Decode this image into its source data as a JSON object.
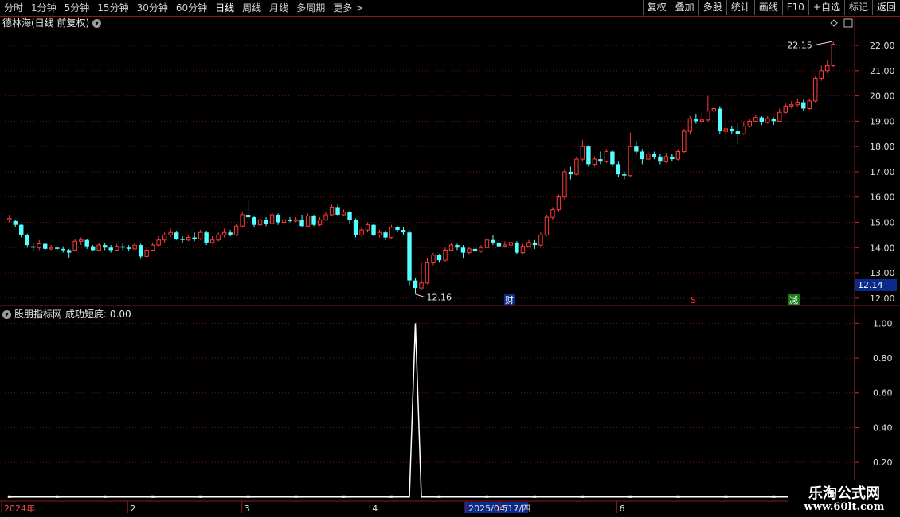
{
  "toolbar": {
    "tabs": [
      "分时",
      "1分钟",
      "5分钟",
      "15分钟",
      "30分钟",
      "60分钟",
      "日线",
      "周线",
      "月线",
      "多周期",
      "更多 >"
    ],
    "active_tab": "日线",
    "right_buttons": [
      "复权",
      "叠加",
      "多股",
      "统计",
      "画线",
      "F10",
      "+自选",
      "标记",
      "返回"
    ]
  },
  "main_chart": {
    "title": "德林海(日线 前复权)",
    "high_label": "22.15",
    "low_label": "12.16",
    "current_price_tag": "12.14",
    "markers": {
      "cai": "财",
      "s": "S",
      "jian": "减"
    }
  },
  "indicator": {
    "title": "股朋指标网",
    "value_label": "成功短底: 0.00"
  },
  "watermark": {
    "line1": "乐淘公式网",
    "line2": "www.60lt.com"
  },
  "colors": {
    "up": "#ff3b3b",
    "down": "#54ffff",
    "grid": "#7a1010",
    "axis_text": "#e0e0e0"
  },
  "chart_data": [
    {
      "type": "candlestick",
      "title": "德林海(日线 前复权)",
      "y_ticks": [
        12.0,
        13.0,
        14.0,
        15.0,
        16.0,
        17.0,
        18.0,
        19.0,
        20.0,
        21.0,
        22.0
      ],
      "ylim": [
        11.9,
        22.6
      ],
      "annotations": [
        {
          "text": "22.15",
          "value": 22.15,
          "type": "high"
        },
        {
          "text": "12.16",
          "value": 12.16,
          "type": "low"
        }
      ],
      "x_ticks": [
        "2024年",
        "2",
        "3",
        "4",
        "2025/04/17/四",
        "5",
        "6"
      ],
      "candles": [
        [
          15.1,
          15.15,
          15.3,
          15.0
        ],
        [
          15.05,
          14.9,
          15.1,
          14.8
        ],
        [
          14.9,
          14.5,
          14.95,
          14.4
        ],
        [
          14.5,
          14.1,
          14.55,
          14.0
        ],
        [
          14.05,
          14.0,
          14.2,
          13.85
        ],
        [
          14.0,
          14.15,
          14.3,
          13.9
        ],
        [
          14.15,
          13.95,
          14.2,
          13.85
        ],
        [
          13.95,
          14.0,
          14.1,
          13.9
        ],
        [
          14.0,
          13.95,
          14.1,
          13.85
        ],
        [
          13.95,
          13.9,
          14.05,
          13.8
        ],
        [
          13.9,
          13.8,
          13.95,
          13.6
        ],
        [
          13.9,
          14.25,
          14.35,
          13.85
        ],
        [
          14.25,
          14.3,
          14.4,
          14.1
        ],
        [
          14.3,
          14.05,
          14.35,
          13.95
        ],
        [
          14.05,
          13.9,
          14.1,
          13.85
        ],
        [
          13.9,
          14.1,
          14.2,
          13.85
        ],
        [
          14.1,
          14.0,
          14.2,
          13.9
        ],
        [
          14.0,
          13.9,
          14.1,
          13.8
        ],
        [
          13.9,
          14.05,
          14.15,
          13.85
        ],
        [
          14.05,
          14.0,
          14.2,
          13.9
        ],
        [
          14.0,
          13.95,
          14.1,
          13.85
        ],
        [
          13.95,
          14.1,
          14.2,
          13.9
        ],
        [
          14.1,
          13.65,
          14.15,
          13.55
        ],
        [
          13.65,
          13.9,
          14.0,
          13.6
        ],
        [
          13.9,
          14.1,
          14.2,
          13.85
        ],
        [
          14.1,
          14.3,
          14.45,
          14.05
        ],
        [
          14.3,
          14.5,
          14.6,
          14.2
        ],
        [
          14.5,
          14.6,
          14.75,
          14.4
        ],
        [
          14.6,
          14.35,
          14.65,
          14.3
        ],
        [
          14.35,
          14.3,
          14.45,
          14.2
        ],
        [
          14.3,
          14.4,
          14.5,
          14.25
        ],
        [
          14.4,
          14.35,
          14.6,
          14.25
        ],
        [
          14.35,
          14.6,
          14.7,
          14.3
        ],
        [
          14.6,
          14.2,
          14.65,
          14.1
        ],
        [
          14.2,
          14.3,
          14.45,
          14.15
        ],
        [
          14.3,
          14.5,
          14.6,
          14.25
        ],
        [
          14.5,
          14.6,
          14.75,
          14.4
        ],
        [
          14.6,
          14.5,
          14.7,
          14.45
        ],
        [
          14.5,
          14.85,
          14.95,
          14.45
        ],
        [
          14.85,
          15.3,
          15.4,
          14.8
        ],
        [
          15.3,
          15.2,
          15.85,
          15.1
        ],
        [
          15.2,
          14.9,
          15.25,
          14.8
        ],
        [
          14.9,
          15.1,
          15.2,
          14.85
        ],
        [
          15.1,
          14.95,
          15.2,
          14.85
        ],
        [
          14.95,
          15.3,
          15.4,
          14.9
        ],
        [
          15.3,
          15.0,
          15.35,
          14.9
        ],
        [
          15.0,
          15.1,
          15.2,
          14.95
        ],
        [
          15.1,
          15.05,
          15.2,
          15.0
        ],
        [
          15.05,
          15.1,
          15.2,
          15.0
        ],
        [
          15.1,
          14.85,
          15.3,
          14.8
        ],
        [
          14.85,
          15.25,
          15.35,
          14.8
        ],
        [
          15.25,
          14.9,
          15.3,
          14.85
        ],
        [
          14.9,
          15.1,
          15.2,
          14.85
        ],
        [
          15.1,
          15.3,
          15.4,
          15.05
        ],
        [
          15.3,
          15.6,
          15.7,
          15.25
        ],
        [
          15.6,
          15.3,
          15.7,
          15.25
        ],
        [
          15.3,
          15.4,
          15.5,
          15.25
        ],
        [
          15.4,
          15.1,
          15.45,
          14.95
        ],
        [
          15.1,
          14.5,
          15.15,
          14.4
        ],
        [
          14.5,
          14.7,
          14.8,
          14.4
        ],
        [
          14.7,
          14.9,
          15.0,
          14.6
        ],
        [
          14.9,
          14.5,
          14.95,
          14.45
        ],
        [
          14.5,
          14.6,
          14.7,
          14.4
        ],
        [
          14.6,
          14.4,
          14.65,
          14.3
        ],
        [
          14.4,
          14.8,
          14.9,
          14.35
        ],
        [
          14.8,
          14.7,
          14.85,
          14.6
        ],
        [
          14.7,
          14.6,
          14.8,
          14.5
        ],
        [
          14.6,
          12.7,
          14.65,
          12.5
        ],
        [
          12.7,
          12.4,
          12.8,
          12.16
        ],
        [
          12.4,
          12.6,
          13.4,
          12.3
        ],
        [
          12.6,
          13.4,
          13.6,
          12.55
        ],
        [
          13.4,
          13.7,
          13.8,
          13.3
        ],
        [
          13.7,
          13.5,
          13.75,
          13.4
        ],
        [
          13.5,
          13.9,
          14.0,
          13.45
        ],
        [
          13.9,
          14.1,
          14.2,
          13.85
        ],
        [
          14.1,
          14.0,
          14.15,
          13.9
        ],
        [
          14.0,
          13.8,
          14.1,
          13.6
        ],
        [
          13.8,
          13.95,
          14.05,
          13.75
        ],
        [
          13.95,
          13.85,
          14.0,
          13.8
        ],
        [
          13.85,
          14.0,
          14.1,
          13.8
        ],
        [
          14.0,
          14.3,
          14.4,
          13.95
        ],
        [
          14.3,
          14.2,
          14.5,
          14.1
        ],
        [
          14.2,
          14.05,
          14.3,
          14.0
        ],
        [
          14.05,
          14.1,
          14.25,
          14.0
        ],
        [
          14.1,
          14.2,
          14.3,
          13.9
        ],
        [
          14.2,
          13.8,
          14.25,
          13.75
        ],
        [
          13.8,
          14.05,
          14.15,
          13.75
        ],
        [
          14.05,
          14.2,
          14.3,
          14.0
        ],
        [
          14.2,
          14.1,
          14.3,
          13.95
        ],
        [
          14.1,
          14.5,
          14.6,
          14.05
        ],
        [
          14.5,
          15.2,
          15.3,
          14.45
        ],
        [
          15.2,
          15.5,
          15.6,
          15.1
        ],
        [
          15.5,
          16.0,
          16.1,
          15.4
        ],
        [
          16.0,
          17.0,
          17.1,
          15.9
        ],
        [
          17.0,
          16.9,
          17.2,
          16.7
        ],
        [
          16.9,
          17.5,
          17.6,
          16.85
        ],
        [
          17.5,
          18.0,
          18.25,
          17.4
        ],
        [
          18.0,
          17.3,
          18.05,
          17.2
        ],
        [
          17.3,
          17.5,
          17.6,
          17.2
        ],
        [
          17.5,
          17.4,
          17.8,
          17.3
        ],
        [
          17.4,
          17.8,
          17.9,
          17.35
        ],
        [
          17.8,
          17.3,
          17.85,
          17.2
        ],
        [
          17.3,
          16.9,
          17.4,
          16.8
        ],
        [
          16.9,
          16.85,
          17.0,
          16.7
        ],
        [
          16.85,
          18.0,
          18.55,
          16.8
        ],
        [
          18.0,
          17.8,
          18.2,
          17.7
        ],
        [
          17.8,
          17.5,
          17.9,
          17.3
        ],
        [
          17.5,
          17.7,
          17.8,
          17.45
        ],
        [
          17.7,
          17.6,
          17.8,
          17.5
        ],
        [
          17.6,
          17.4,
          17.7,
          17.3
        ],
        [
          17.4,
          17.6,
          17.75,
          17.35
        ],
        [
          17.6,
          17.5,
          17.7,
          17.4
        ],
        [
          17.5,
          17.8,
          17.9,
          17.45
        ],
        [
          17.8,
          18.6,
          18.7,
          17.75
        ],
        [
          18.6,
          19.1,
          19.2,
          18.5
        ],
        [
          19.1,
          19.0,
          19.3,
          18.9
        ],
        [
          19.0,
          19.05,
          19.4,
          18.9
        ],
        [
          19.05,
          19.4,
          20.0,
          18.95
        ],
        [
          19.4,
          19.5,
          19.6,
          19.3
        ],
        [
          19.5,
          18.6,
          19.6,
          18.5
        ],
        [
          18.6,
          18.7,
          18.9,
          18.3
        ],
        [
          18.7,
          18.6,
          18.8,
          18.5
        ],
        [
          18.6,
          18.5,
          18.9,
          18.1
        ],
        [
          18.5,
          18.8,
          18.95,
          18.45
        ],
        [
          18.8,
          19.0,
          19.1,
          18.75
        ],
        [
          19.0,
          19.15,
          19.25,
          18.95
        ],
        [
          19.15,
          18.95,
          19.2,
          18.85
        ],
        [
          18.95,
          19.1,
          19.2,
          18.9
        ],
        [
          19.1,
          19.0,
          19.15,
          18.85
        ],
        [
          19.0,
          19.35,
          19.5,
          18.95
        ],
        [
          19.35,
          19.6,
          19.7,
          19.3
        ],
        [
          19.6,
          19.65,
          19.8,
          19.5
        ],
        [
          19.65,
          19.75,
          19.9,
          19.55
        ],
        [
          19.75,
          19.5,
          19.85,
          19.4
        ],
        [
          19.5,
          19.8,
          19.9,
          19.45
        ],
        [
          19.8,
          20.7,
          20.8,
          19.75
        ],
        [
          20.7,
          21.0,
          21.2,
          20.6
        ],
        [
          21.0,
          21.2,
          21.4,
          20.9
        ],
        [
          21.2,
          22.05,
          22.15,
          21.15
        ]
      ]
    },
    {
      "type": "line",
      "title": "成功短底",
      "y_ticks": [
        0.2,
        0.4,
        0.6,
        0.8,
        1.0
      ],
      "ylim": [
        -0.01,
        1.02
      ],
      "values_note": "",
      "series": [
        {
          "name": "成功短底",
          "values": [
            0,
            0,
            0,
            0,
            0,
            0,
            0,
            0,
            0,
            0,
            0,
            0,
            0,
            0,
            0,
            0,
            0,
            0,
            0,
            0,
            0,
            0,
            0,
            0,
            0,
            0,
            0,
            0,
            0,
            0,
            0,
            0,
            0,
            0,
            0,
            0,
            0,
            0,
            0,
            0,
            0,
            0,
            0,
            0,
            0,
            0,
            0,
            0,
            0,
            0,
            0,
            0,
            0,
            0,
            0,
            0,
            0,
            0,
            0,
            0,
            0,
            0,
            0,
            0,
            0,
            0,
            0,
            0,
            1,
            0,
            0,
            0,
            0,
            0,
            0,
            0,
            0,
            0,
            0,
            0,
            0,
            0,
            0,
            0,
            0,
            0,
            0,
            0,
            0,
            0,
            0,
            0,
            0,
            0,
            0,
            0,
            0,
            0,
            0,
            0,
            0,
            0,
            0,
            0,
            0,
            0,
            0,
            0,
            0,
            0,
            0,
            0,
            0,
            0,
            0,
            0,
            0,
            0,
            0,
            0,
            0,
            0,
            0,
            0,
            0,
            0,
            0,
            0,
            0,
            0,
            0,
            0,
            0,
            0,
            0,
            0,
            0,
            0,
            0,
            0,
            0,
            0,
            0,
            0,
            0,
            0,
            0,
            0,
            0
          ]
        }
      ]
    }
  ]
}
